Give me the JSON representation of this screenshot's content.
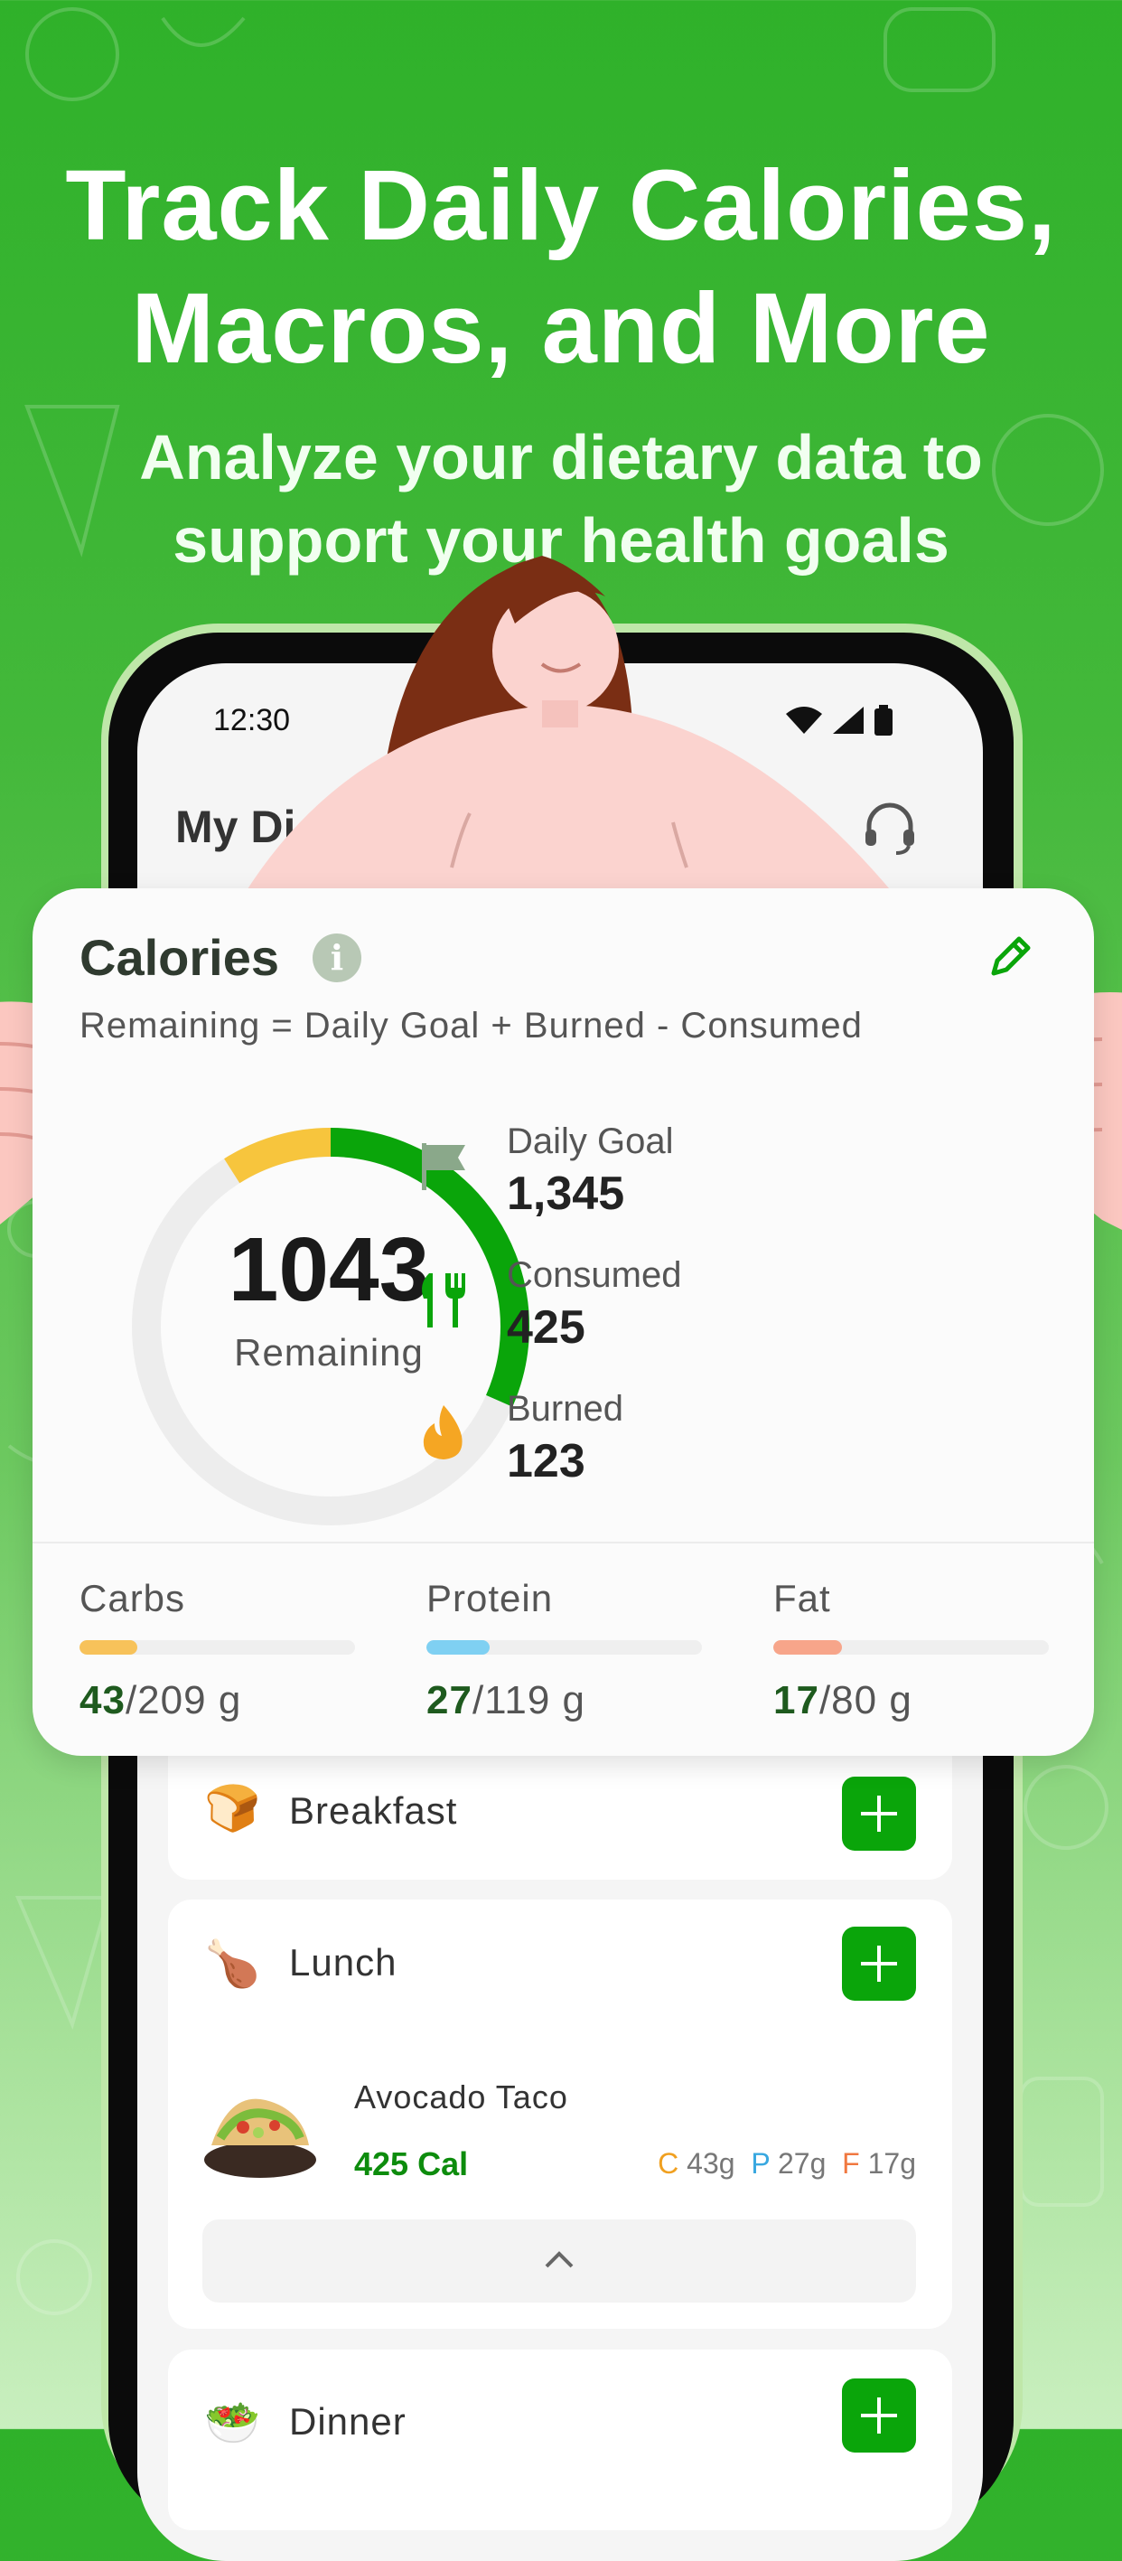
{
  "headline": {
    "line1": "Track Daily Calories,",
    "line2": "Macros, and More"
  },
  "subheadline": {
    "line1": "Analyze your dietary data to",
    "line2": "support your health goals"
  },
  "status_bar": {
    "time": "12:30"
  },
  "app_header": {
    "title": "My Di"
  },
  "calories": {
    "title": "Calories",
    "formula": "Remaining = Daily Goal + Burned - Consumed",
    "remaining_value": "1043",
    "remaining_label": "Remaining",
    "stats": [
      {
        "label": "Daily Goal",
        "value": "1,345",
        "icon": "flag-icon"
      },
      {
        "label": "Consumed",
        "value": "425",
        "icon": "fork-knife-icon"
      },
      {
        "label": "Burned",
        "value": "123",
        "icon": "flame-icon"
      }
    ],
    "ring": {
      "consumed_fraction": 0.316,
      "burned_fraction": 0.09
    },
    "macros": [
      {
        "label": "Carbs",
        "current": "43",
        "goal": "/209 g",
        "fraction": 0.21,
        "color": "#f7c25a"
      },
      {
        "label": "Protein",
        "current": "27",
        "goal": "/119 g",
        "fraction": 0.23,
        "color": "#7fd0f2"
      },
      {
        "label": "Fat",
        "current": "17",
        "goal": "/80 g",
        "fraction": 0.25,
        "color": "#f7a58a"
      }
    ]
  },
  "meals": {
    "breakfast": {
      "name": "Breakfast",
      "icon": "bread-icon"
    },
    "lunch": {
      "name": "Lunch",
      "icon": "drumstick-icon",
      "food": {
        "name": "Avocado Taco",
        "calories": "425 Cal",
        "c_letter": "C",
        "c_value": "43g",
        "p_letter": "P",
        "p_value": "27g",
        "f_letter": "F",
        "f_value": "17g"
      }
    },
    "dinner": {
      "name": "Dinner",
      "icon": "salad-icon"
    }
  },
  "colors": {
    "brand_green": "#0aa50a",
    "burned_yellow": "#f7c53d",
    "background_green": "#2fb12a"
  }
}
